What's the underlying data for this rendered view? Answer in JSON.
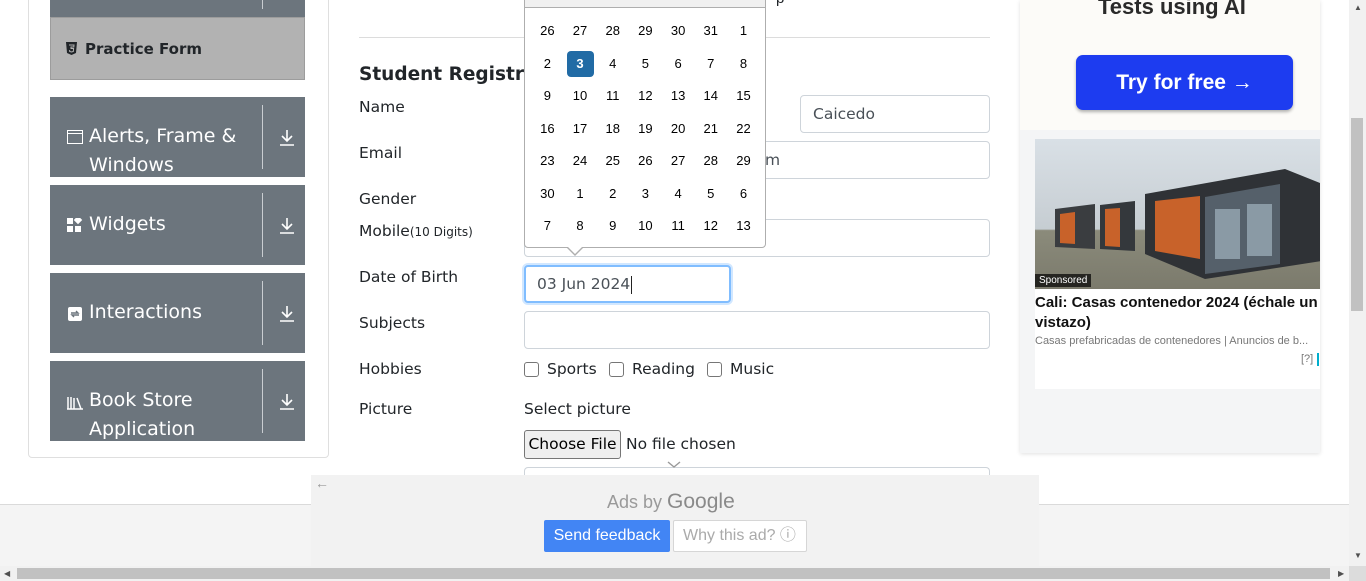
{
  "sidebar": {
    "practice_form": "Practice Form",
    "groups": [
      {
        "label_line1": "Alerts, Frame &",
        "label_line2": "Windows",
        "icon": "window-icon"
      },
      {
        "label_line1": "Widgets",
        "label_line2": "",
        "icon": "widgets-icon"
      },
      {
        "label_line1": "Interactions",
        "label_line2": "",
        "icon": "interactions-icon"
      },
      {
        "label_line1": "Book Store",
        "label_line2": "Application",
        "icon": "books-icon"
      }
    ]
  },
  "top_partial_text": "p",
  "form": {
    "title": "Student Registratio",
    "labels": {
      "name": "Name",
      "email": "Email",
      "gender": "Gender",
      "mobile": "Mobile",
      "mobile_hint": "(10 Digits)",
      "dob": "Date of Birth",
      "subjects": "Subjects",
      "hobbies": "Hobbies",
      "picture": "Picture"
    },
    "last_name_value": "Caicedo",
    "email_partial": "m",
    "dob_value": "03 Jun 2024",
    "hobbies": [
      "Sports",
      "Reading",
      "Music"
    ],
    "select_picture": "Select picture",
    "choose_file": "Choose File",
    "no_file": "No file chosen"
  },
  "calendar": {
    "selected": "3",
    "weeks": [
      [
        "26",
        "27",
        "28",
        "29",
        "30",
        "31",
        "1"
      ],
      [
        "2",
        "3",
        "4",
        "5",
        "6",
        "7",
        "8"
      ],
      [
        "9",
        "10",
        "11",
        "12",
        "13",
        "14",
        "15"
      ],
      [
        "16",
        "17",
        "18",
        "19",
        "20",
        "21",
        "22"
      ],
      [
        "23",
        "24",
        "25",
        "26",
        "27",
        "28",
        "29"
      ],
      [
        "30",
        "1",
        "2",
        "3",
        "4",
        "5",
        "6"
      ],
      [
        "7",
        "8",
        "9",
        "10",
        "11",
        "12",
        "13"
      ]
    ]
  },
  "ad_right": {
    "headline": "Tests using AI",
    "cta": "Try for free →",
    "sponsored": "Sponsored",
    "card_title": "Cali: Casas contenedor 2024 (échale un vistazo)",
    "card_sub": "Casas prefabricadas de contenedores | Anuncios de b...",
    "info_q": "[?]",
    "close": "✕"
  },
  "google_ad": {
    "ads_by": "Ads by",
    "google": "Google",
    "send_feedback": "Send feedback",
    "why_ad": "Why this ad? ⓘ",
    "back": "←"
  },
  "colors": {
    "sidebar_bg": "#6c757d",
    "selected_day": "#216ba5",
    "cta_blue": "#1d3cf0",
    "feedback_blue": "#4285f4"
  }
}
